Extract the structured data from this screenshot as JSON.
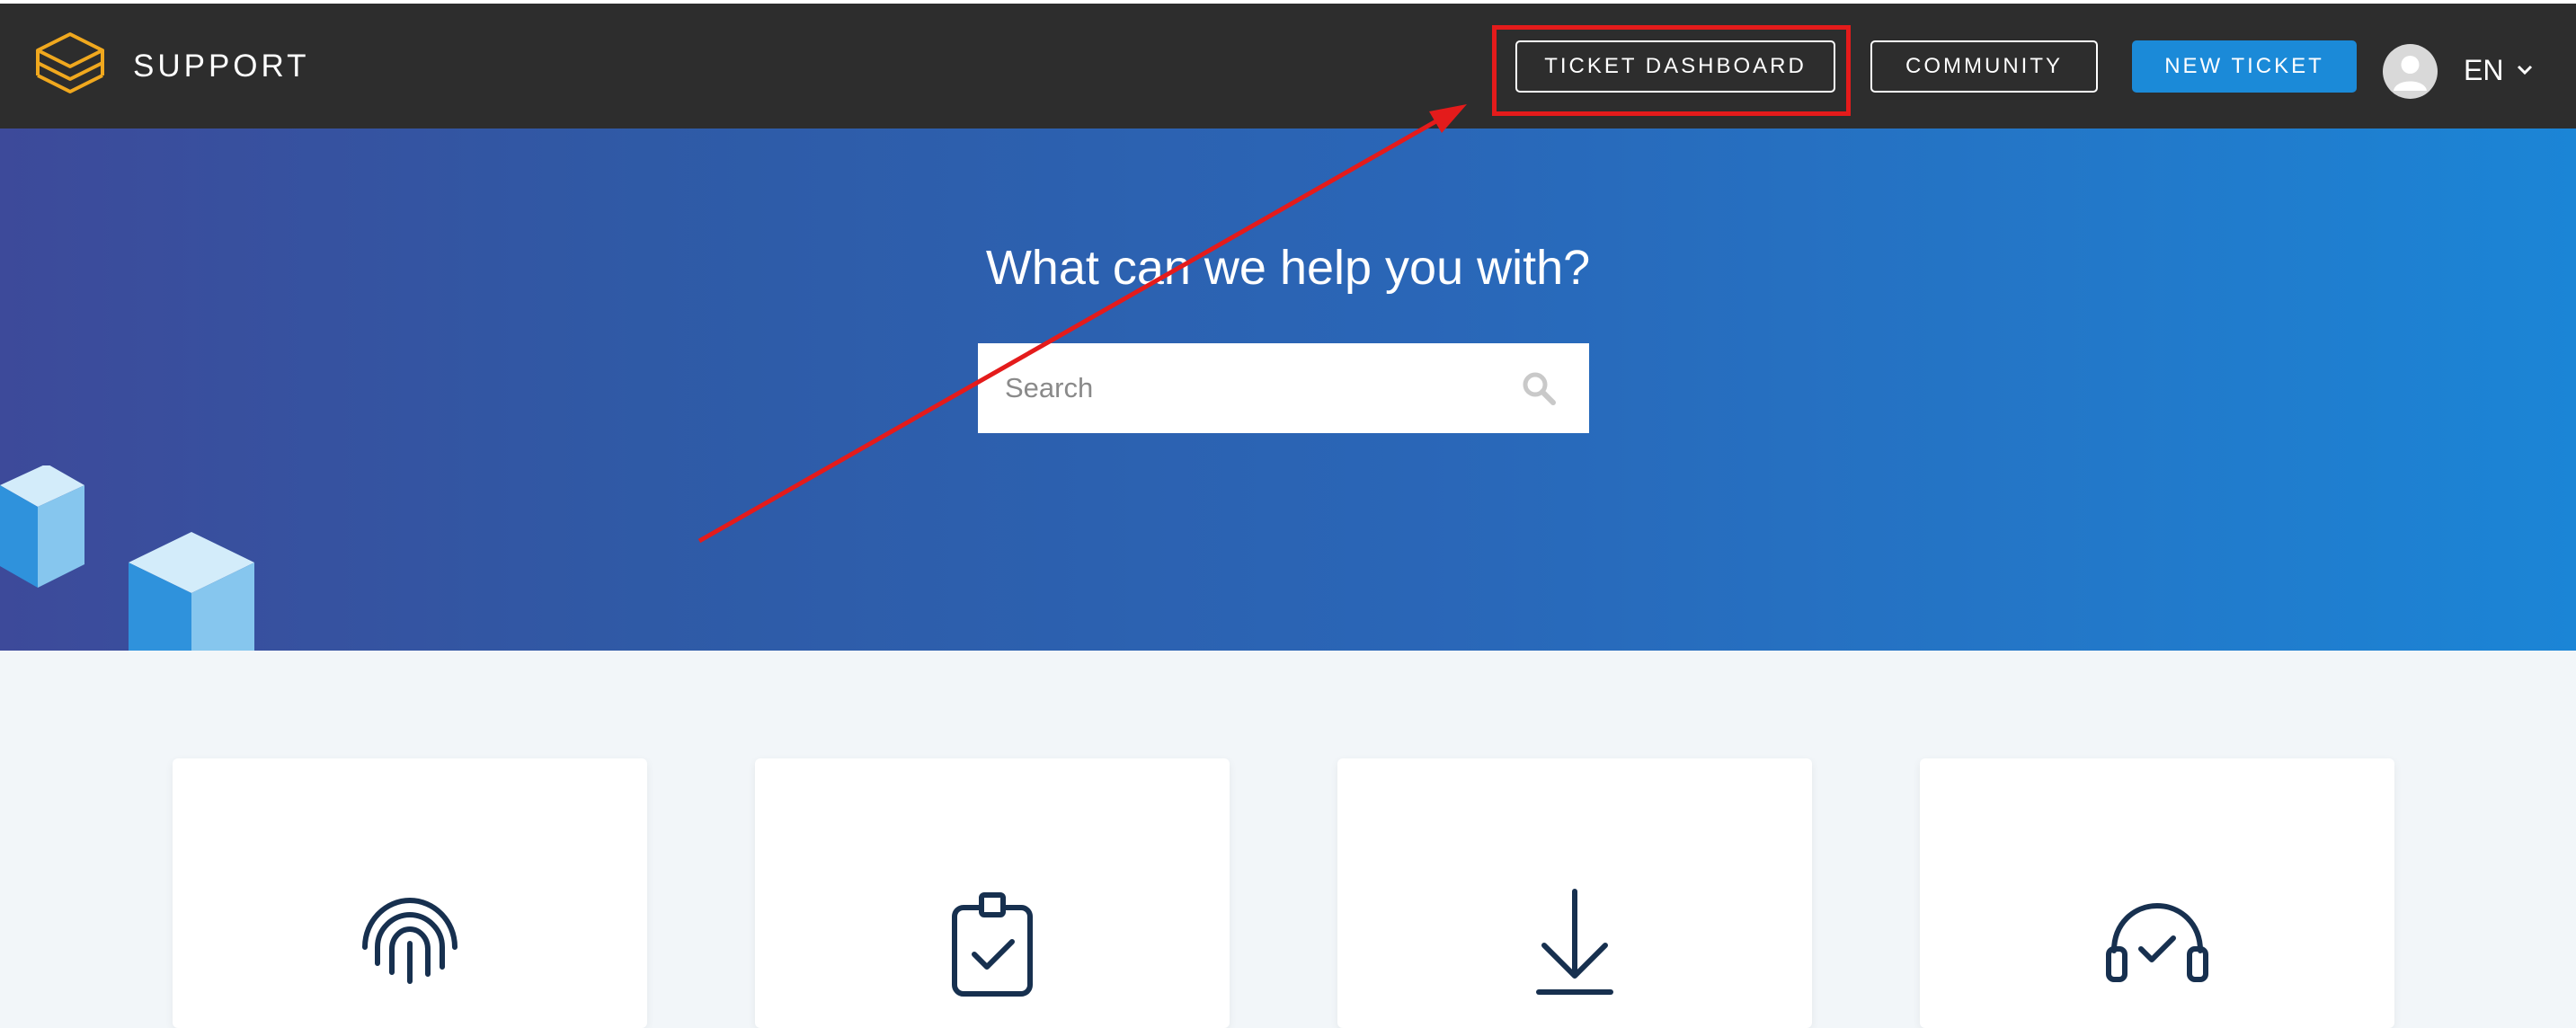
{
  "header": {
    "brand": "SUPPORT",
    "nav": {
      "ticket_dashboard": "TICKET DASHBOARD",
      "community": "COMMUNITY",
      "new_ticket": "NEW TICKET"
    },
    "language": "EN"
  },
  "hero": {
    "title": "What can we help you with?",
    "search_placeholder": "Search"
  },
  "cards": [
    {
      "icon": "fingerprint-icon"
    },
    {
      "icon": "clipboard-check-icon"
    },
    {
      "icon": "download-icon"
    },
    {
      "icon": "headset-check-icon"
    }
  ],
  "annotation": {
    "highlight_color": "#e41b1b",
    "target": "TICKET DASHBOARD"
  },
  "colors": {
    "header_bg": "#2d2d2d",
    "accent_button": "#1b8ad8",
    "logo": "#f0a81e",
    "icon_stroke": "#17304f"
  }
}
